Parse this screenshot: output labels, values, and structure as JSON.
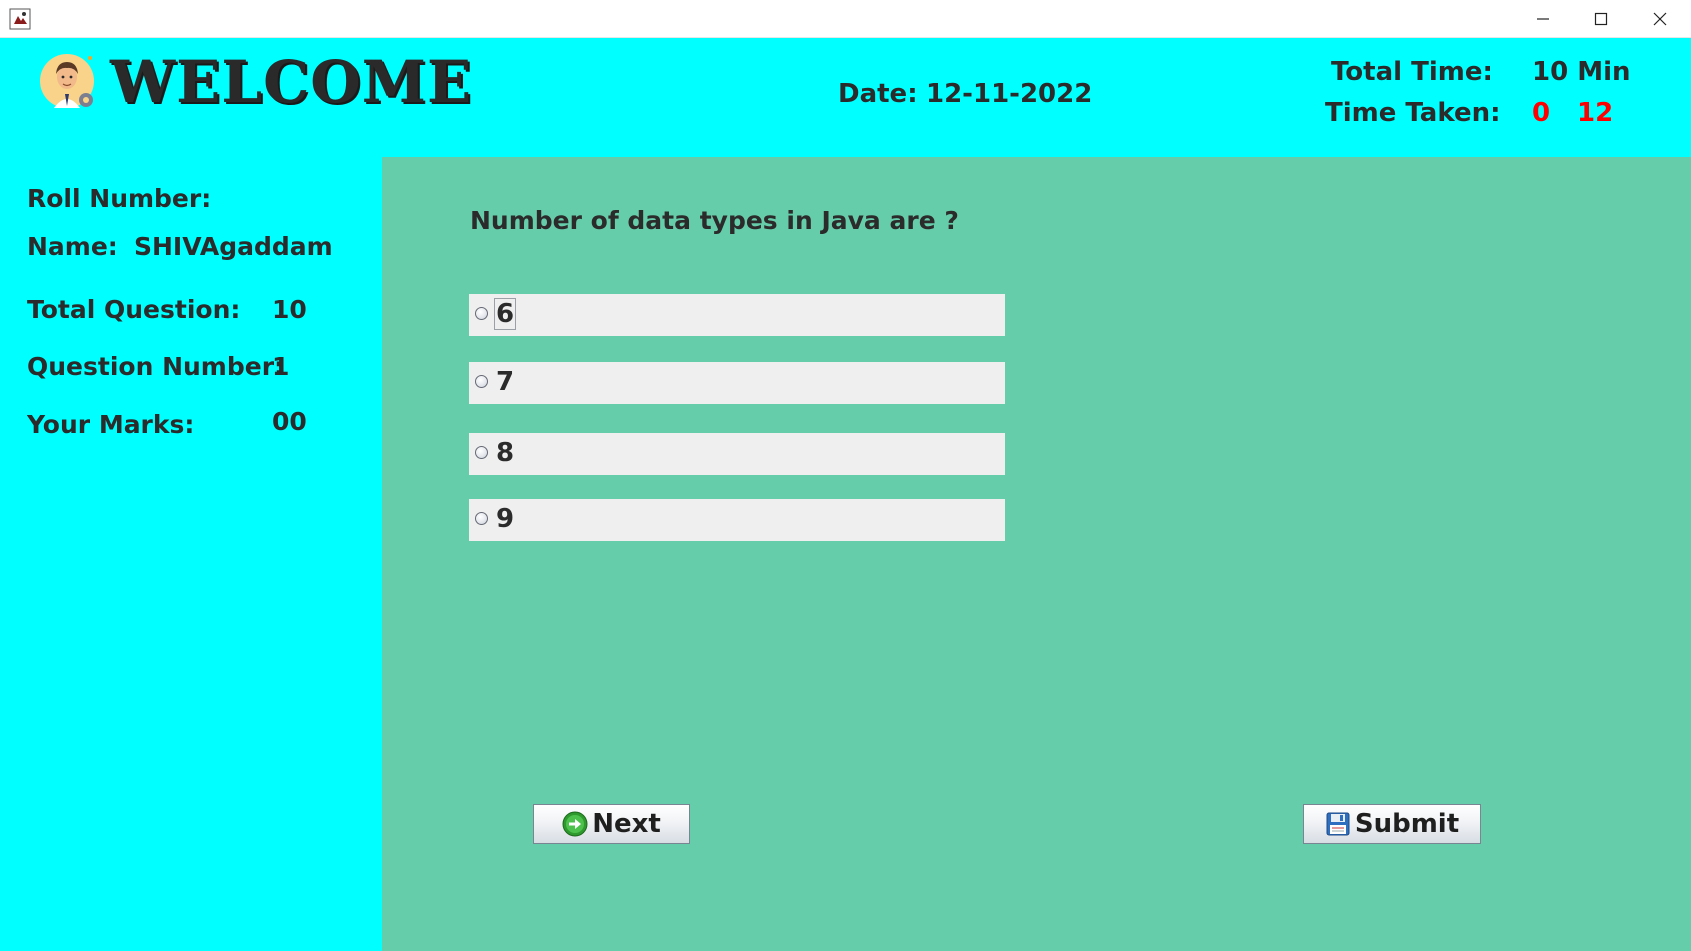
{
  "window": {
    "controls": [
      "minimize-icon",
      "maximize-icon",
      "close-icon"
    ]
  },
  "header": {
    "welcome": "WELCOME",
    "date_label": "Date:",
    "date_value": "12-11-2022",
    "total_time_label": "Total Time:",
    "total_time_value": "10 Min",
    "time_taken_label": "Time Taken:",
    "time_taken_min": "0",
    "time_taken_sec": "12"
  },
  "sidebar": {
    "roll_label": "Roll Number:",
    "roll_value": "",
    "name_label": "Name:",
    "name_value": "SHIVAgaddam",
    "total_question_label": "Total Question:",
    "total_question_value": "10",
    "question_number_label": "Question Number:",
    "question_number_value": "1",
    "marks_label": "Your Marks:",
    "marks_value": "00"
  },
  "main": {
    "question": "Number of data types in Java are ?",
    "options": [
      {
        "label": "6",
        "selected": false
      },
      {
        "label": "7",
        "selected": false
      },
      {
        "label": "8",
        "selected": false
      },
      {
        "label": "9",
        "selected": false
      }
    ],
    "next_label": "Next",
    "submit_label": "Submit"
  },
  "colors": {
    "header_bg": "#00ffff",
    "main_bg": "#66cdaa",
    "timer": "#ff0000"
  }
}
